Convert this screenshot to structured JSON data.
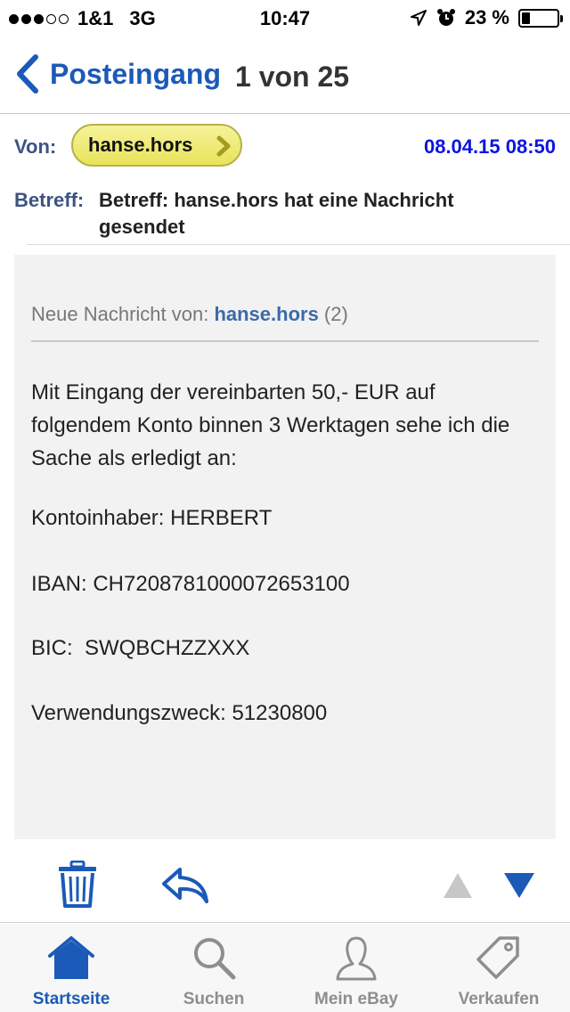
{
  "status": {
    "carrier": "1&1",
    "network": "3G",
    "time": "10:47",
    "battery": "23 %",
    "battery_level": 0.23,
    "signal_bars_filled": 3,
    "signal_bars_total": 5
  },
  "nav": {
    "back_label": "Posteingang",
    "counter": "1 von 25"
  },
  "header": {
    "from_label": "Von:",
    "sender": "hanse.hors",
    "date": "08.04.15 08:50",
    "subject_label": "Betreff:",
    "subject": "Betreff: hanse.hors hat eine Nachricht gesendet"
  },
  "message": {
    "intro_prefix": "Neue Nachricht von: ",
    "intro_sender": "hanse.hors",
    "intro_count": " (2)",
    "body_text": "Mit Eingang der vereinbarten 50,- EUR auf folgendem Konto binnen 3 Werktagen sehe ich die Sache als erledigt an:",
    "account_holder": "Kontoinhaber: HERBERT",
    "iban": "IBAN: CH7208781000072653100",
    "bic": "BIC:  SWQBCHZZXXX",
    "reference": "Verwendungszweck: 51230800"
  },
  "toolbar": {
    "delete_icon": "trash-icon",
    "reply_icon": "reply-icon",
    "prev_icon": "arrow-up-icon",
    "next_icon": "arrow-down-icon"
  },
  "tabs": [
    {
      "label": "Startseite",
      "icon": "home-icon",
      "active": true
    },
    {
      "label": "Suchen",
      "icon": "search-icon",
      "active": false
    },
    {
      "label": "Mein eBay",
      "icon": "user-icon",
      "active": false
    },
    {
      "label": "Verkaufen",
      "icon": "tag-icon",
      "active": false
    }
  ],
  "colors": {
    "accent": "#1b5ab8",
    "date": "#0c16e0",
    "pill": "#f0ec7a",
    "tab_inactive": "#8e8e8e"
  }
}
